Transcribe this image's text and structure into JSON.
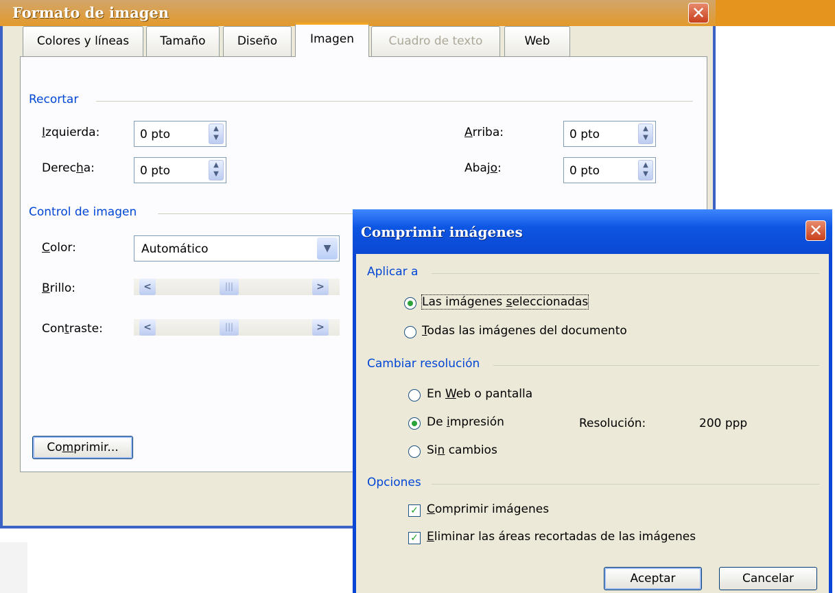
{
  "format_dialog": {
    "title": "Formato de imagen",
    "tabs": [
      "Colores y líneas",
      "Tamaño",
      "Diseño",
      "Imagen",
      "Cuadro de texto",
      "Web"
    ],
    "active_tab": "Imagen",
    "disabled_tab": "Cuadro de texto",
    "crop": {
      "label": "Recortar",
      "left_label_u": "I",
      "left_label_rest": "zquierda:",
      "left_value": "0 pto",
      "right_label_pre": "Derec",
      "right_label_u": "h",
      "right_label_post": "a:",
      "right_value": "0 pto",
      "top_label_u": "A",
      "top_label_rest": "rriba:",
      "top_value": "0 pto",
      "bottom_label_pre": "Abaj",
      "bottom_label_u": "o",
      "bottom_label_post": ":",
      "bottom_value": "0 pto"
    },
    "image_control": {
      "label": "Control de imagen",
      "color_label_u": "C",
      "color_label_rest": "olor:",
      "color_value": "Automático",
      "brightness_label_u": "B",
      "brightness_label_rest": "rillo:",
      "contrast_label_pre": "Con",
      "contrast_label_u": "t",
      "contrast_label_post": "raste:"
    },
    "compress_button_pre": "Co",
    "compress_button_u": "m",
    "compress_button_post": "primir..."
  },
  "compress_dialog": {
    "title": "Comprimir imágenes",
    "apply_to": {
      "label": "Aplicar a",
      "selected_pre": "Las imágenes ",
      "selected_u": "s",
      "selected_post": "eleccionadas",
      "all_u": "T",
      "all_rest": "odas las imágenes del documento",
      "selected_option": "Las imágenes seleccionadas"
    },
    "resolution": {
      "label": "Cambiar resolución",
      "web_pre": "En ",
      "web_u": "W",
      "web_post": "eb o pantalla",
      "print_pre": "De ",
      "print_u": "i",
      "print_post": "mpresión",
      "none_pre": "Si",
      "none_u": "n",
      "none_post": " cambios",
      "resolution_label": "Resolución:",
      "resolution_value": "200 ppp",
      "selected_option": "De impresión"
    },
    "options": {
      "label": "Opciones",
      "compress_u": "C",
      "compress_rest": "omprimir imágenes",
      "compress_checked": true,
      "delete_u": "E",
      "delete_rest": "liminar las áreas recortadas de las imágenes",
      "delete_checked": true
    },
    "ok_label": "Aceptar",
    "cancel_label": "Cancelar"
  }
}
